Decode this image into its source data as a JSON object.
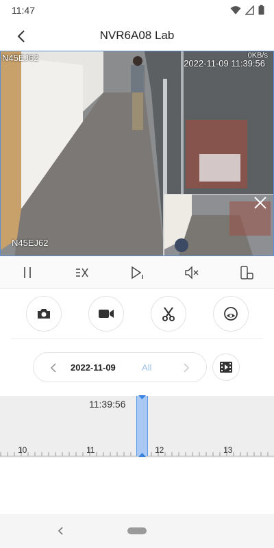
{
  "status": {
    "time": "11:47"
  },
  "header": {
    "title": "NVR6A08 Lab"
  },
  "video": {
    "camera_top": "N45EJ62",
    "camera_bottom": "N45EJ62",
    "timestamp": "2022-11-09 11:39:56",
    "speed": "0KB/s"
  },
  "toolbar": {
    "pause_icon": "pause-icon",
    "speed_icon": "speed-icon",
    "step_icon": "frame-step-icon",
    "mute_icon": "mute-icon",
    "rotate_icon": "rotate-screen-icon"
  },
  "actions": {
    "snapshot_icon": "camera-icon",
    "record_icon": "video-record-icon",
    "clip_icon": "scissors-icon",
    "view_icon": "eye-icon"
  },
  "date_picker": {
    "date": "2022-11-09",
    "filter": "All"
  },
  "timeline": {
    "cursor_time": "11:39:56",
    "hours": [
      "10",
      "11",
      "12",
      "13"
    ]
  },
  "colors": {
    "accent": "#5a98e8",
    "filter_text": "#9ec3ee",
    "cursor_fill": "#a9c9f4"
  }
}
